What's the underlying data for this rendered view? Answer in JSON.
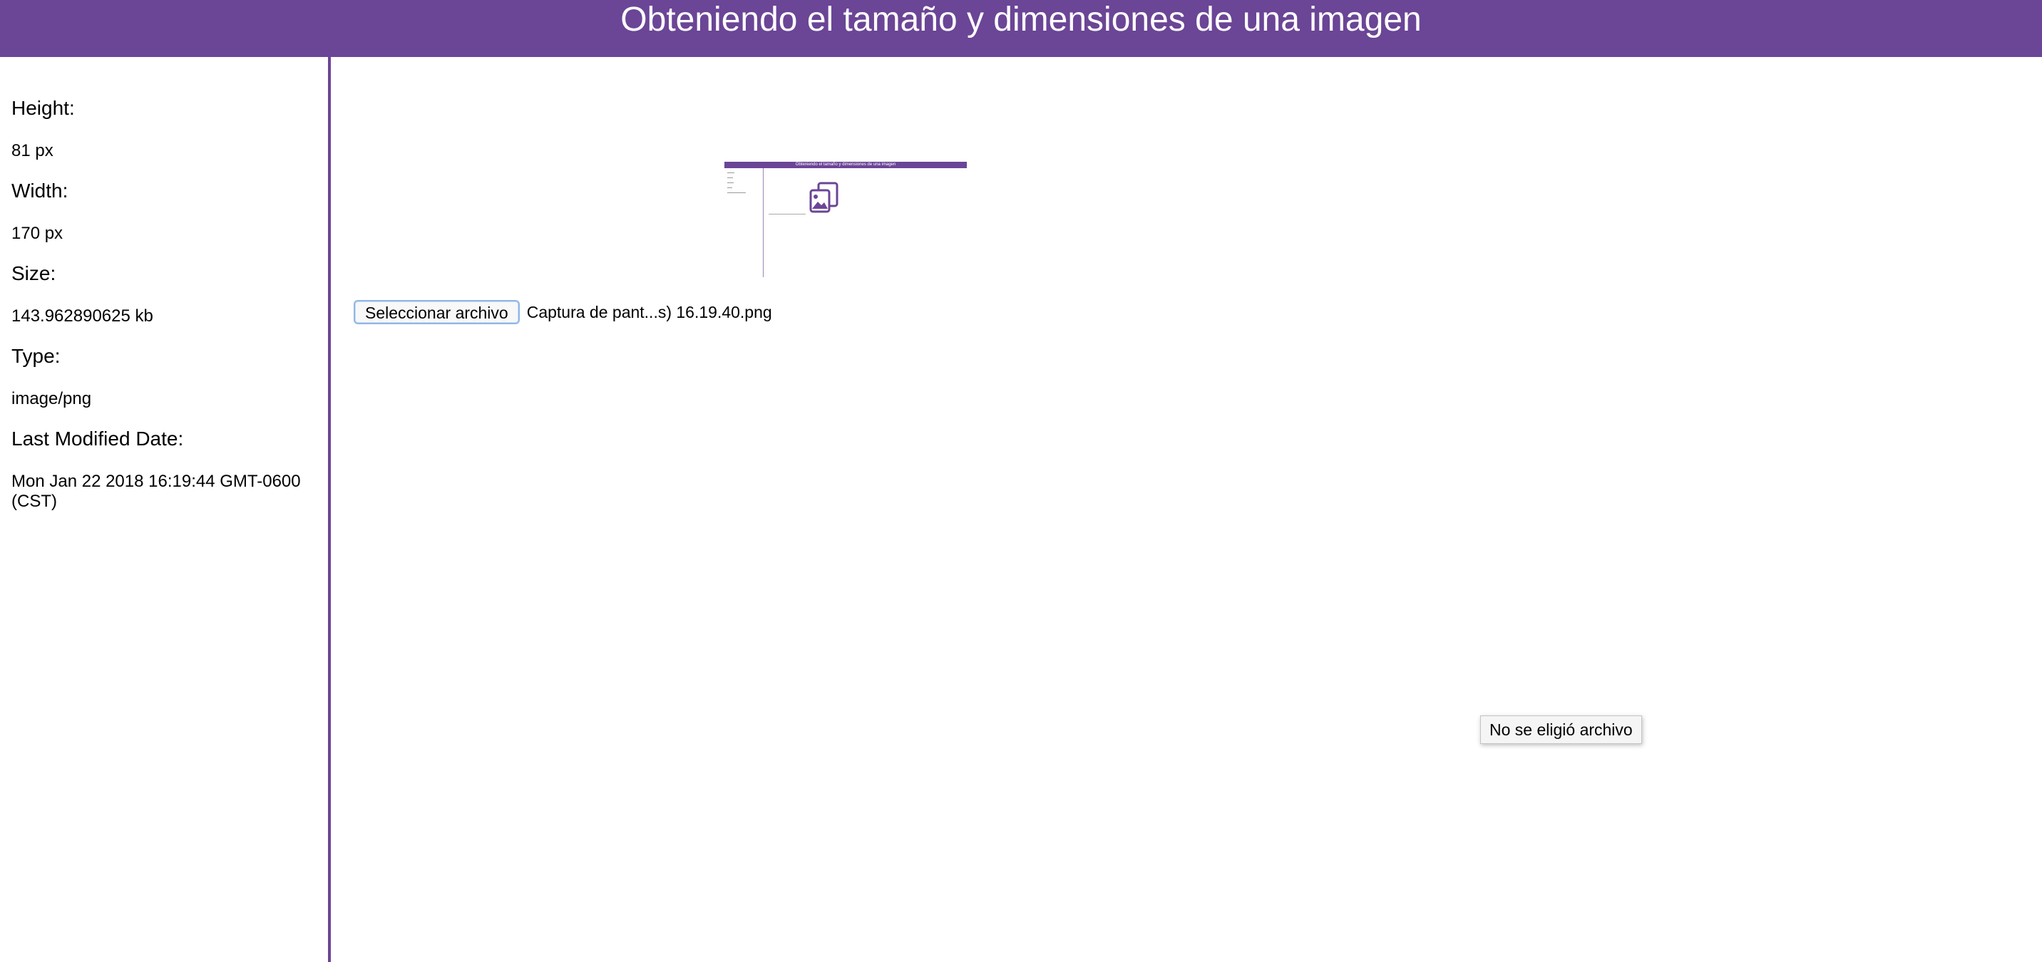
{
  "header": {
    "title": "Obteniendo el tamaño y dimensiones de una imagen"
  },
  "sidebar": {
    "height_label": "Height:",
    "height_value": "81 px",
    "width_label": "Width:",
    "width_value": "170 px",
    "size_label": "Size:",
    "size_value": "143.962890625 kb",
    "type_label": "Type:",
    "type_value": "image/png",
    "modified_label": "Last Modified Date:",
    "modified_value": "Mon Jan 22 2018 16:19:44 GMT-0600 (CST)"
  },
  "main": {
    "preview_title": "Obteniendo el tamaño y dimensiones de una imagen",
    "file_button_label": "Seleccionar archivo",
    "file_name": "Captura de pant...s) 16.19.40.png",
    "tooltip_text": "No se eligió archivo"
  },
  "colors": {
    "accent": "#6b4596"
  }
}
